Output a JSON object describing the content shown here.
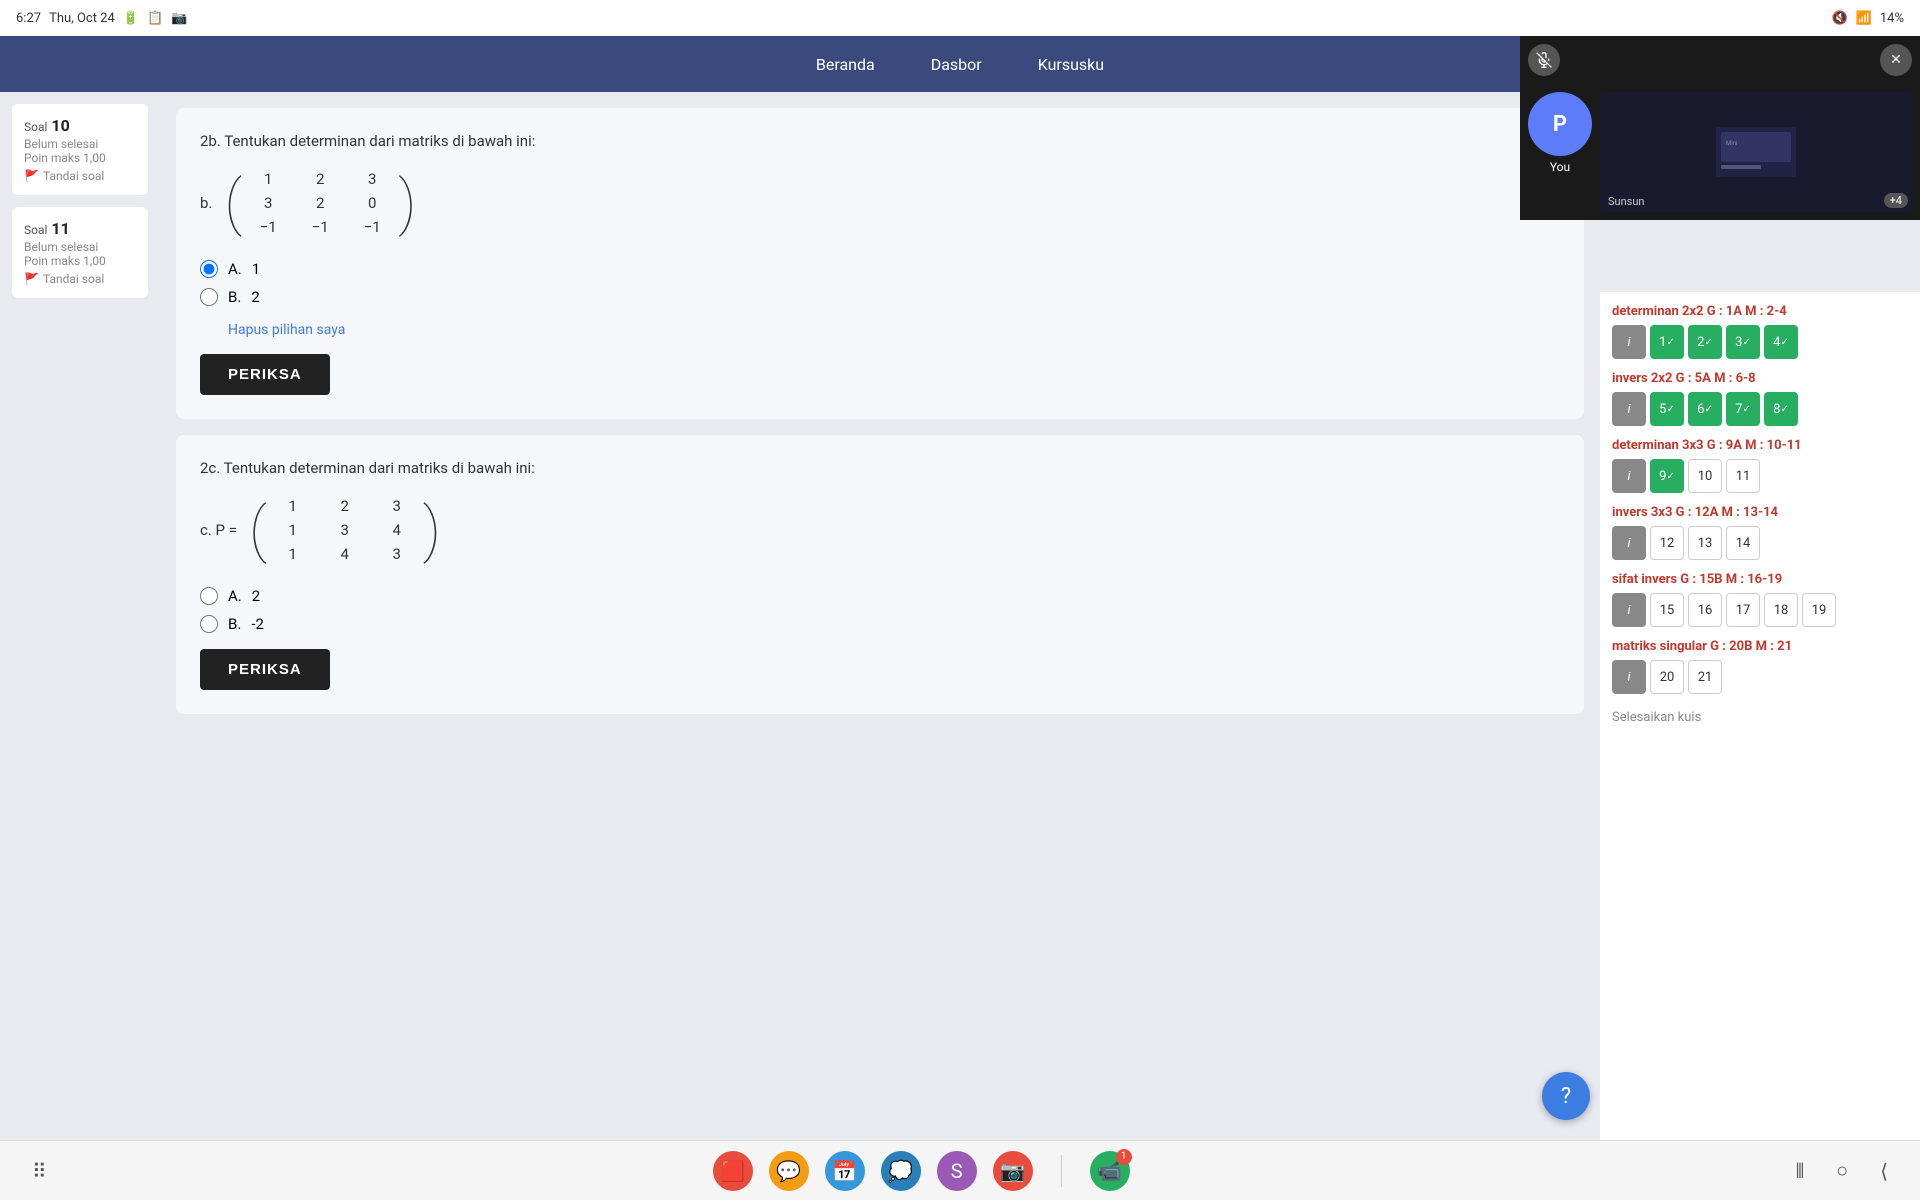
{
  "statusBar": {
    "time": "6:27",
    "date": "Thu, Oct 24",
    "battery": "14%"
  },
  "nav": {
    "items": [
      "Beranda",
      "Dasbor",
      "Kursusku"
    ]
  },
  "soal10": {
    "label": "Soal",
    "number": "10",
    "status": "Belum selesai",
    "poin": "Poin maks 1,00",
    "tandai": "Tandai soal"
  },
  "soal11": {
    "label": "Soal",
    "number": "11",
    "status": "Belum selesai",
    "poin": "Poin maks 1,00",
    "tandai": "Tandai soal"
  },
  "question10": {
    "text": "2b. Tentukan determinan dari matriks di bawah ini:",
    "matrix_prefix": "b.",
    "matrix": [
      [
        "1",
        "2",
        "3"
      ],
      [
        "3",
        "2",
        "0"
      ],
      [
        "-1",
        "-1",
        "-1"
      ]
    ],
    "options": [
      {
        "label": "A.",
        "value": "1",
        "selected": true
      },
      {
        "label": "B.",
        "value": "2",
        "selected": false
      }
    ],
    "hapus": "Hapus pilihan saya",
    "btn": "PERIKSA"
  },
  "question11": {
    "text": "2c. Tentukan determinan dari matriks di bawah ini:",
    "matrix_prefix": "c. P =",
    "matrix": [
      [
        "1",
        "2",
        "3"
      ],
      [
        "1",
        "3",
        "4"
      ],
      [
        "1",
        "4",
        "3"
      ]
    ],
    "options": [
      {
        "label": "A.",
        "value": "2",
        "selected": false
      },
      {
        "label": "B.",
        "value": "-2",
        "selected": false
      }
    ],
    "btn": "PERIKSA"
  },
  "videoOverlay": {
    "participantYou": "You",
    "avatarLetter": "P",
    "screenLabel": "Sunsun",
    "plusBadge": "+4"
  },
  "rightPanel": {
    "sections": [
      {
        "title": "determinan 2x2 G : 1A M : 2-4",
        "numbers": [
          {
            "label": "i",
            "style": "info"
          },
          {
            "label": "1",
            "style": "correct"
          },
          {
            "label": "2",
            "style": "correct"
          },
          {
            "label": "3",
            "style": "correct"
          },
          {
            "label": "4",
            "style": "correct"
          }
        ]
      },
      {
        "title": "invers 2x2 G : 5A M : 6-8",
        "numbers": [
          {
            "label": "i",
            "style": "info"
          },
          {
            "label": "5",
            "style": "correct"
          },
          {
            "label": "6",
            "style": "correct"
          },
          {
            "label": "7",
            "style": "correct"
          },
          {
            "label": "8",
            "style": "correct"
          }
        ]
      },
      {
        "title": "determinan 3x3 G : 9A M : 10-11",
        "numbers": [
          {
            "label": "i",
            "style": "info"
          },
          {
            "label": "9",
            "style": "correct"
          },
          {
            "label": "10",
            "style": "empty"
          },
          {
            "label": "11",
            "style": "empty"
          }
        ]
      },
      {
        "title": "invers 3x3 G : 12A M : 13-14",
        "numbers": [
          {
            "label": "i",
            "style": "info"
          },
          {
            "label": "12",
            "style": "empty"
          },
          {
            "label": "13",
            "style": "empty"
          },
          {
            "label": "14",
            "style": "empty"
          }
        ]
      },
      {
        "title": "sifat invers G : 15B M : 16-19",
        "numbers": [
          {
            "label": "i",
            "style": "info"
          },
          {
            "label": "15",
            "style": "empty"
          },
          {
            "label": "16",
            "style": "empty"
          },
          {
            "label": "17",
            "style": "empty"
          },
          {
            "label": "18",
            "style": "empty"
          },
          {
            "label": "19",
            "style": "empty"
          }
        ]
      },
      {
        "title": "matriks singular G : 20B M : 21",
        "numbers": [
          {
            "label": "i",
            "style": "info"
          },
          {
            "label": "20",
            "style": "empty"
          },
          {
            "label": "21",
            "style": "empty"
          }
        ]
      }
    ],
    "selesaikan": "Selesaikan kuis"
  },
  "fab": "?",
  "bottomBar": {
    "apps": [
      {
        "name": "Flic",
        "color": "#e74c3c",
        "badge": null
      },
      {
        "name": "Messages",
        "color": "#f39c12",
        "badge": null
      },
      {
        "name": "Calendar24",
        "color": "#3498db",
        "badge": null
      },
      {
        "name": "Chat",
        "color": "#2980b9",
        "badge": null
      },
      {
        "name": "Slack",
        "color": "#9b59b6",
        "badge": null
      },
      {
        "name": "Camera",
        "color": "#e74c3c",
        "badge": null
      },
      {
        "name": "GMeet",
        "color": "#27ae60",
        "badge": "1"
      }
    ]
  }
}
